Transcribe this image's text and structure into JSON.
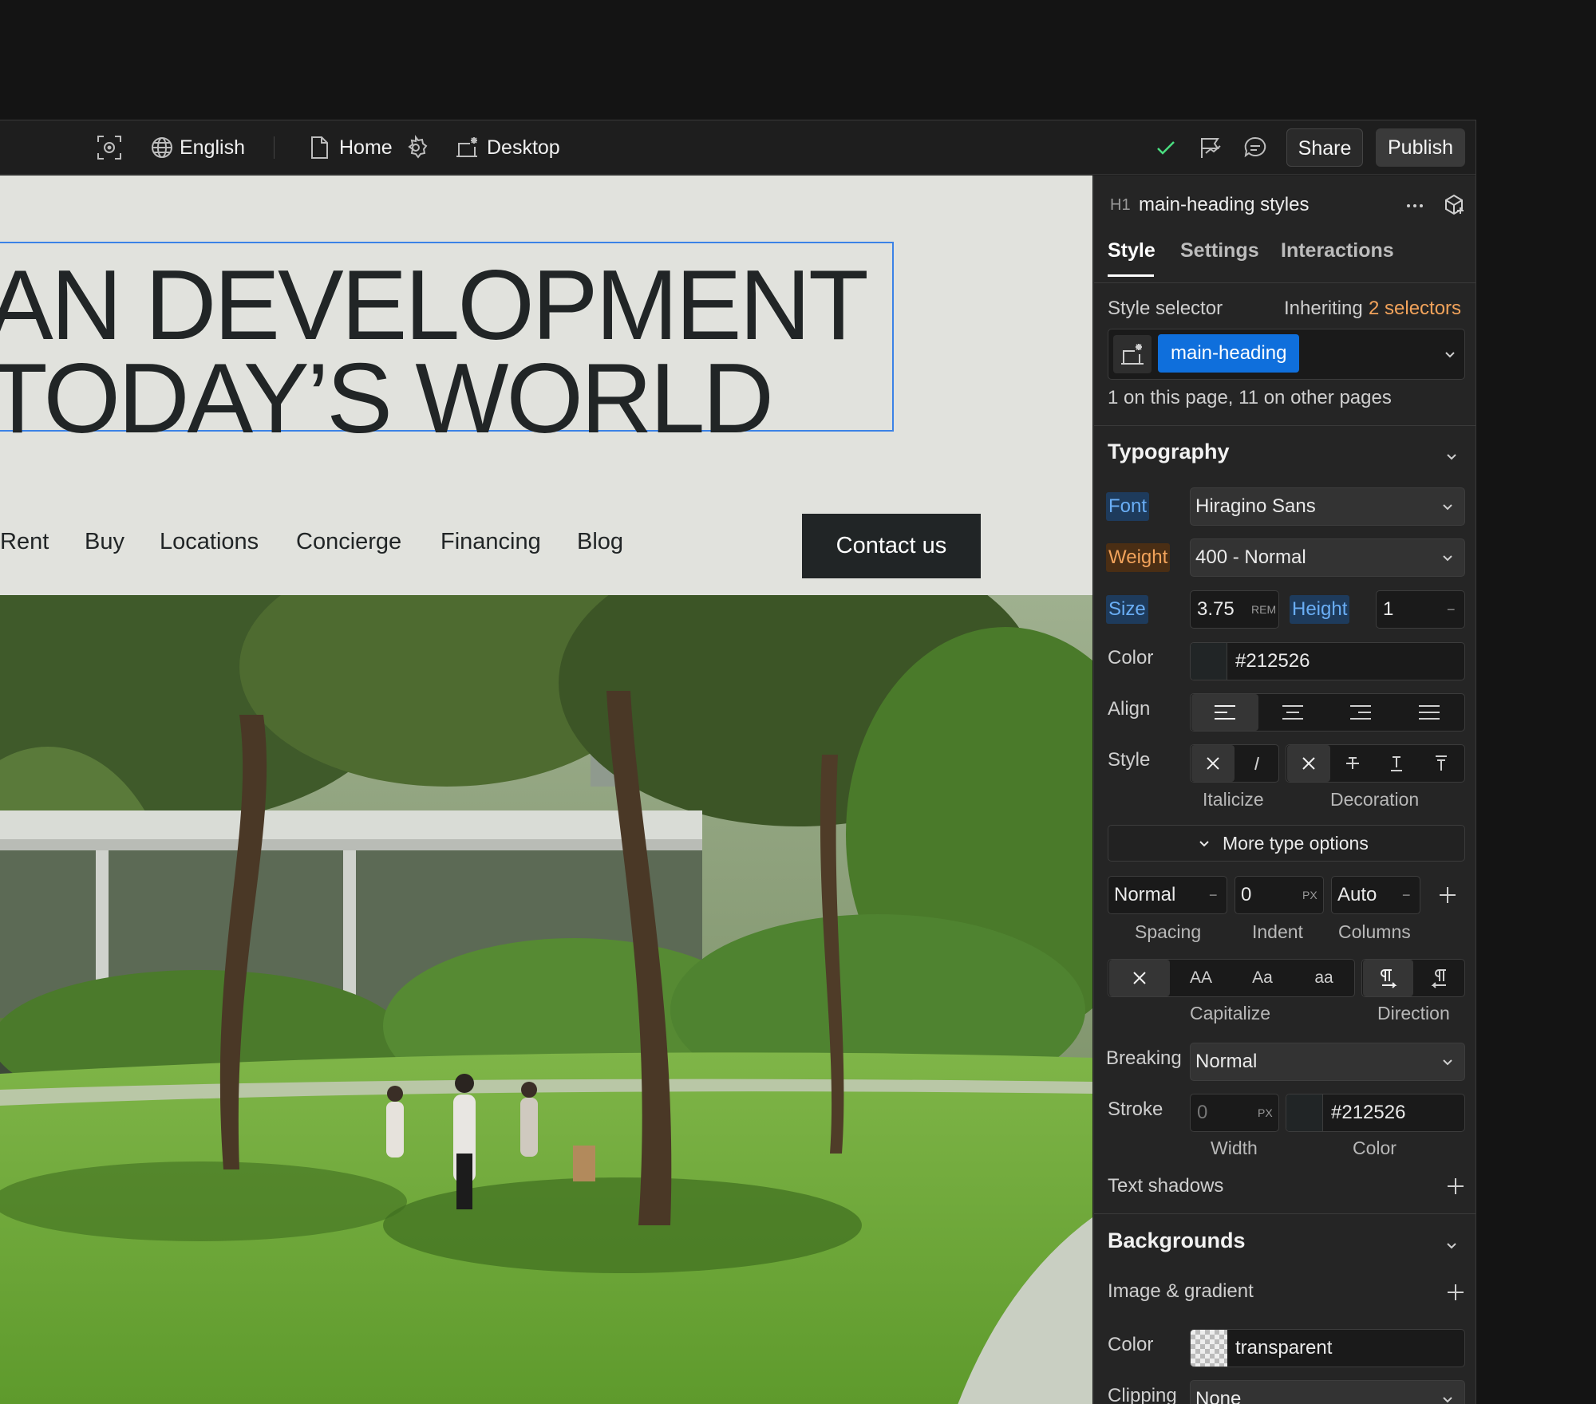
{
  "topbar": {
    "language": "English",
    "page": "Home",
    "breakpoint": "Desktop",
    "share_label": "Share",
    "publish_label": "Publish",
    "icons": [
      "preview-icon",
      "globe-icon",
      "page-icon",
      "gear-icon",
      "desktop-breakpoint-icon",
      "check-icon",
      "flag-icon",
      "comment-icon"
    ]
  },
  "canvas": {
    "heading_lines": [
      "AN DEVELOPMENT",
      "TODAY’S WORLD"
    ],
    "nav": [
      "Rent",
      "Buy",
      "Locations",
      "Concierge",
      "Financing",
      "Blog"
    ],
    "contact_label": "Contact us"
  },
  "panel": {
    "element_tag": "H1",
    "title": "main-heading styles",
    "tabs": [
      "Style",
      "Settings",
      "Interactions"
    ],
    "active_tab": "Style",
    "style_selector_label": "Style selector",
    "inheriting_prefix": "Inheriting",
    "inheriting_count": "2 selectors",
    "selector_chip": "main-heading",
    "selector_usage": "1 on this page, 11 on other pages",
    "typography": {
      "title": "Typography",
      "font_label": "Font",
      "font_value": "Hiragino Sans",
      "weight_label": "Weight",
      "weight_value": "400 - Normal",
      "size_label": "Size",
      "size_value": "3.75",
      "size_unit": "REM",
      "height_label": "Height",
      "height_value": "1",
      "color_label": "Color",
      "color_value": "#212526",
      "align_label": "Align",
      "style_label": "Style",
      "italicize_label": "Italicize",
      "decoration_label": "Decoration",
      "more_options": "More type options",
      "spacing_value": "Normal",
      "indent_value": "0",
      "indent_unit": "PX",
      "columns_value": "Auto",
      "spacing_label": "Spacing",
      "indent_label": "Indent",
      "columns_label": "Columns",
      "caps_options": [
        "AA",
        "Aa",
        "aa"
      ],
      "capitalize_label": "Capitalize",
      "direction_label": "Direction",
      "breaking_label": "Breaking",
      "breaking_value": "Normal",
      "stroke_label": "Stroke",
      "stroke_width": "0",
      "stroke_unit": "PX",
      "stroke_color": "#212526",
      "width_label": "Width",
      "stroke_color_label": "Color",
      "text_shadows": "Text shadows"
    },
    "backgrounds": {
      "title": "Backgrounds",
      "image_gradient": "Image & gradient",
      "color_label": "Color",
      "color_value": "transparent",
      "clipping_label": "Clipping",
      "clipping_value": "None"
    }
  },
  "colors": {
    "accent_blue": "#0f6fdc",
    "selection_blue": "#3b82e6",
    "inherit_orange": "#f2a35b",
    "text_dark": "#212526"
  }
}
